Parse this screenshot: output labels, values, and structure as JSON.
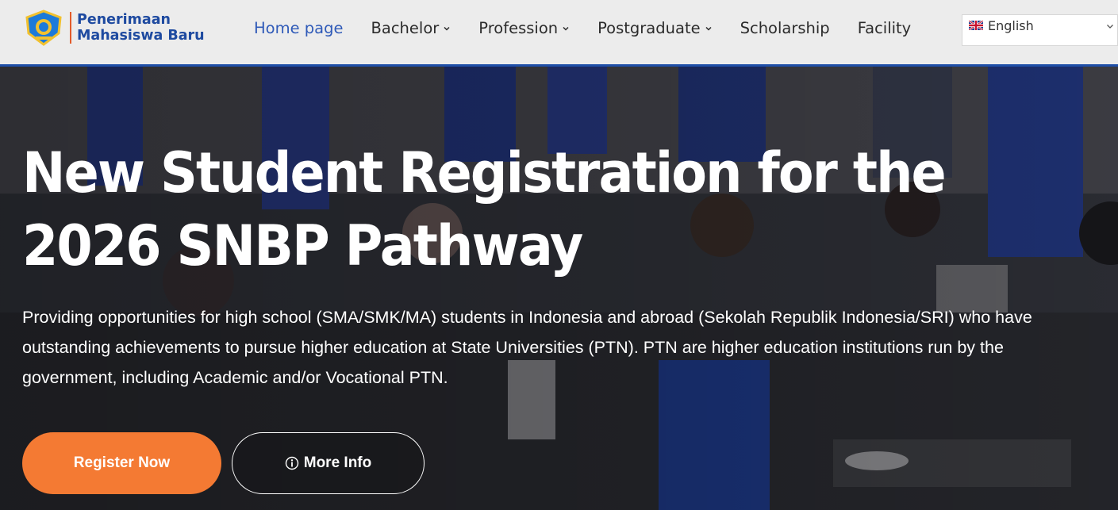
{
  "header": {
    "logo_line1": "Penerimaan",
    "logo_line2": "Mahasiswa Baru",
    "nav": [
      {
        "label": "Home page",
        "active": true,
        "dropdown": false
      },
      {
        "label": "Bachelor",
        "dropdown": true
      },
      {
        "label": "Profession",
        "dropdown": true
      },
      {
        "label": "Postgraduate",
        "dropdown": true
      },
      {
        "label": "Scholarship",
        "dropdown": false
      },
      {
        "label": "Facility",
        "dropdown": false
      }
    ],
    "language": {
      "selected": "English",
      "flag_icon": "uk-flag-icon"
    }
  },
  "hero": {
    "title_line1": "New Student Registration for the",
    "title_line2": "2026 SNBP Pathway",
    "description": "Providing opportunities for high school (SMA/SMK/MA) students in Indonesia and abroad (Sekolah Republik Indonesia/SRI) who have outstanding achievements to pursue higher education at State Universities (PTN). PTN are higher education institutions run by the government, including Academic and/or Vocational PTN.",
    "register_button": "Register Now",
    "more_info_button": "More Info"
  },
  "colors": {
    "brand_blue": "#1e4aa0",
    "nav_active": "#2f5ab8",
    "accent_orange": "#f47a33",
    "header_bg": "#ececec"
  }
}
